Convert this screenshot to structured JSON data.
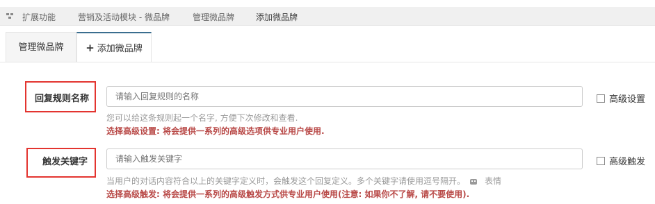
{
  "breadcrumb": {
    "items": [
      "扩展功能",
      "营销及活动模块 - 微品牌",
      "管理微品牌",
      "添加微品牌"
    ]
  },
  "tabs": [
    {
      "label": "管理微品牌",
      "active": false
    },
    {
      "label": "添加微品牌",
      "active": true,
      "icon": "plus-icon"
    }
  ],
  "form": {
    "rule_name": {
      "label": "回复规则名称",
      "placeholder": "请输入回复规则的名称",
      "help": "您可以给这条规则起一个名字, 方便下次修改和查看.",
      "warning": "选择高级设置: 将会提供一系列的高级选项供专业用户使用.",
      "checkbox_label": "高级设置",
      "checked": false
    },
    "keyword": {
      "label": "触发关键字",
      "placeholder": "请输入触发关键字",
      "help": "当用户的对话内容符合以上的关键字定义时，会触发这个回复定义。多个关键字请使用逗号隔开。",
      "emoji_label": "表情",
      "warning": "选择高级触发: 将会提供一系列的高级触发方式供专业用户使用(注意: 如果你不了解, 请不要使用).",
      "checkbox_label": "高级触发",
      "checked": false
    }
  },
  "colors": {
    "highlight": "#e3342f",
    "warning": "#b94a48",
    "tab_active_border": "#3a6e8f"
  }
}
